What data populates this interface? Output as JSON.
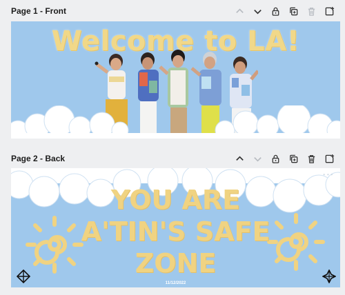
{
  "pages": [
    {
      "title": "Page 1 - Front",
      "design": {
        "headline": "Welcome to LA!"
      },
      "controls": [
        "chevron-up",
        "chevron-down",
        "lock",
        "duplicate",
        "delete",
        "add-page"
      ]
    },
    {
      "title": "Page 2 - Back",
      "design": {
        "line1": "YOU ARE",
        "line2": "A'TIN'S SAFE",
        "line3": "ZONE",
        "date": "11/12/2022"
      },
      "controls": [
        "chevron-up",
        "chevron-down",
        "lock",
        "duplicate",
        "delete",
        "add-page"
      ]
    }
  ],
  "colors": {
    "background": "#eeeff1",
    "canvas_sky": "#9fc8ec",
    "title_yellow": "#f1d889",
    "cloud_white": "#ffffff"
  }
}
